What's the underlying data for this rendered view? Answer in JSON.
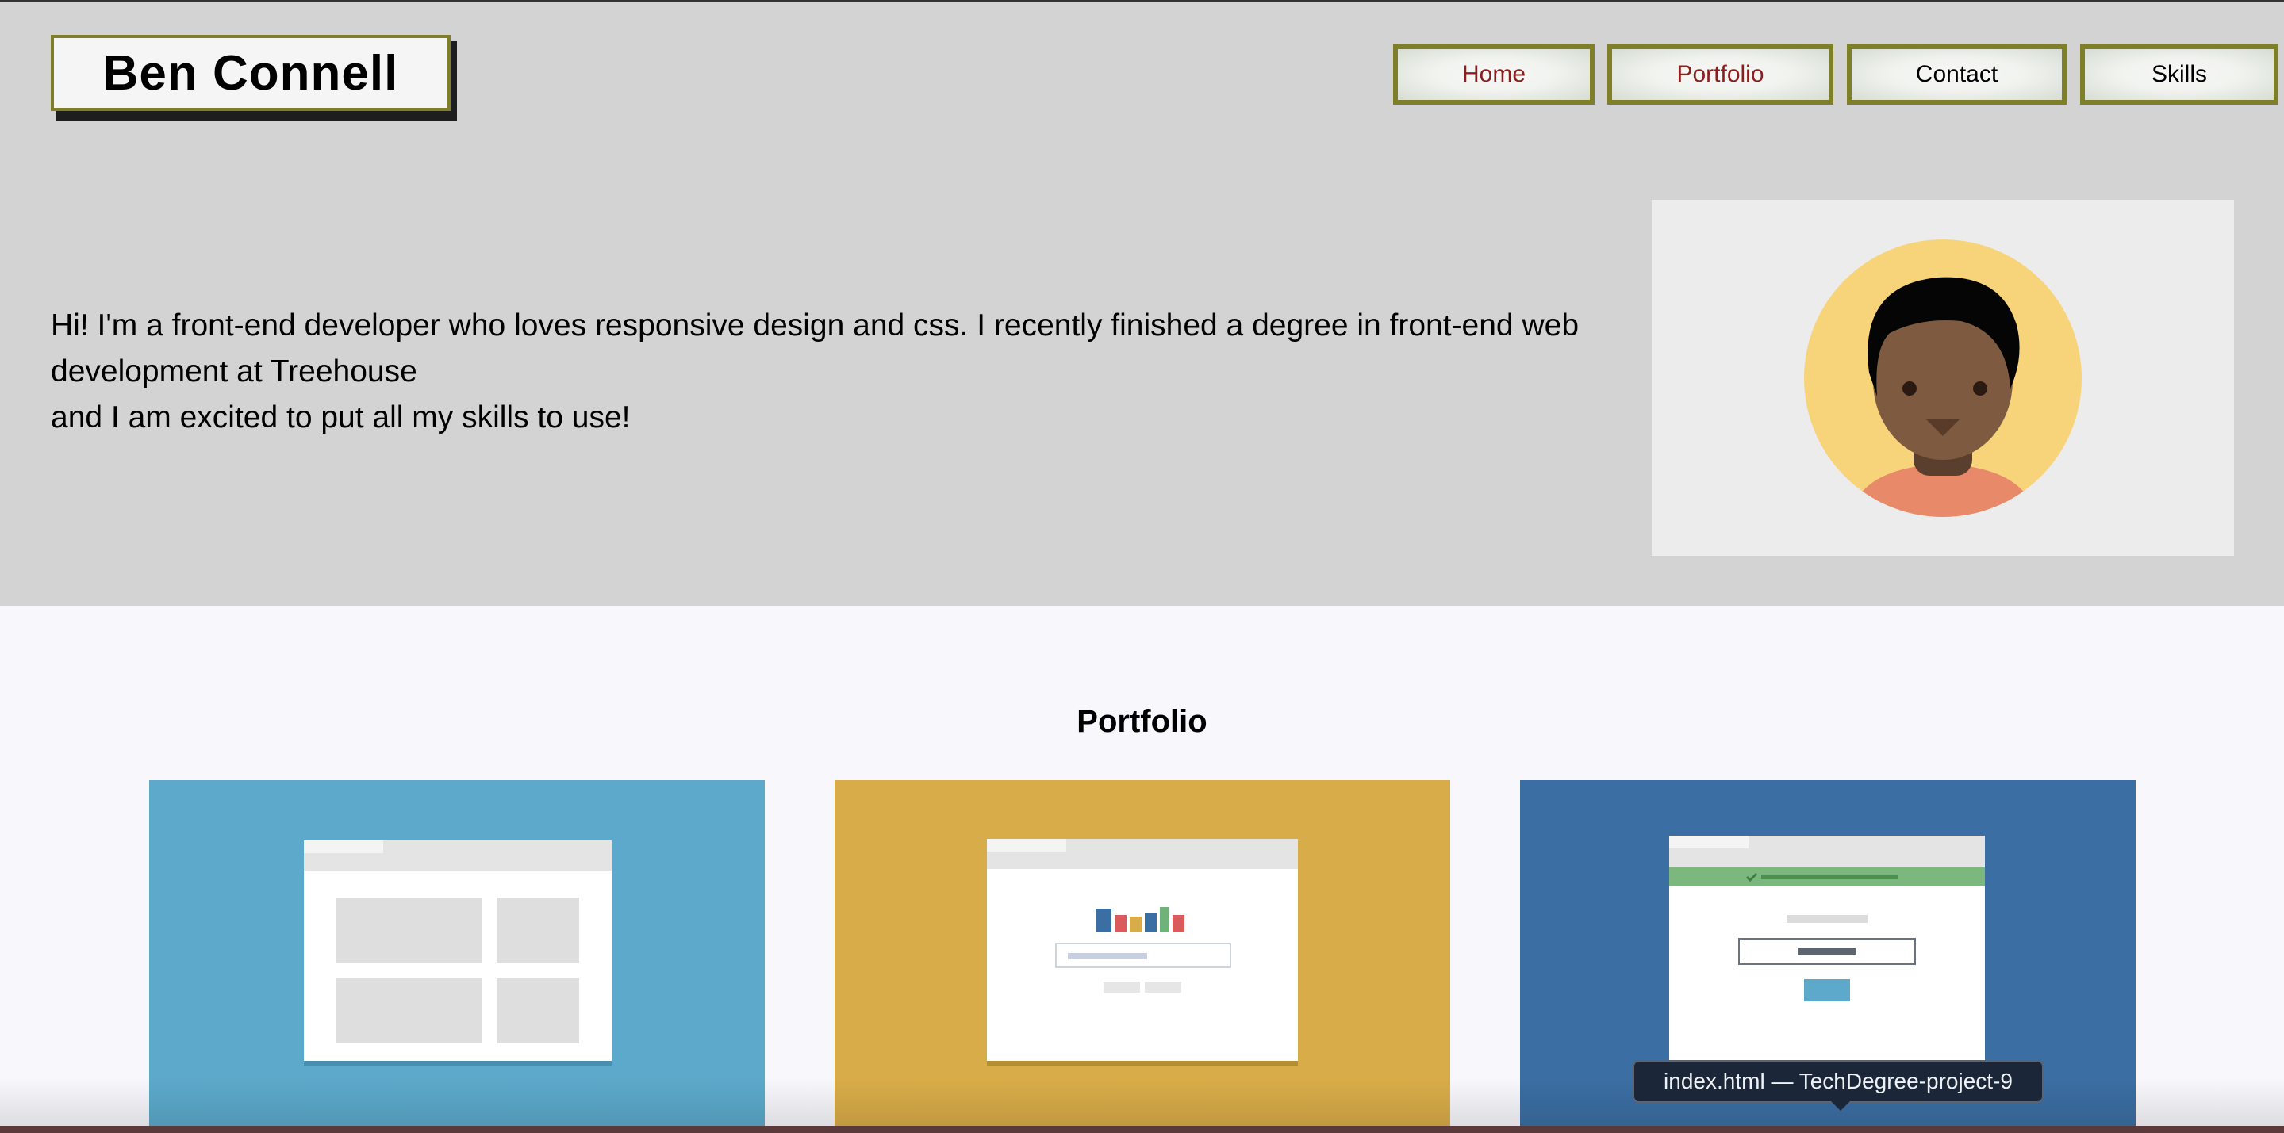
{
  "header": {
    "logo": "Ben Connell",
    "nav": [
      {
        "label": "Home",
        "color": "#8c1e1e"
      },
      {
        "label": "Portfolio",
        "color": "#8c1e1e"
      },
      {
        "label": "Contact",
        "color": "#000000"
      },
      {
        "label": "Skills",
        "color": "#000000"
      }
    ],
    "border_color": "#7f7f2a"
  },
  "hero": {
    "intro_line_1": "Hi! I'm a front-end developer who loves responsive design and css. I recently finished a degree in front-end web development at Treehouse",
    "intro_line_2": "and I am excited to put all my skills to use!",
    "avatar_icon": "person-avatar-icon",
    "background": "#d3d3d3"
  },
  "portfolio": {
    "title": "Portfolio",
    "cards": [
      {
        "icon": "layout-grid-icon",
        "color": "#5ca9cb"
      },
      {
        "icon": "bar-chart-form-icon",
        "color": "#d8ac48"
      },
      {
        "icon": "login-form-icon",
        "color": "#3b6ea3"
      }
    ]
  },
  "tooltip": {
    "text": "index.html — TechDegree-project-9"
  }
}
